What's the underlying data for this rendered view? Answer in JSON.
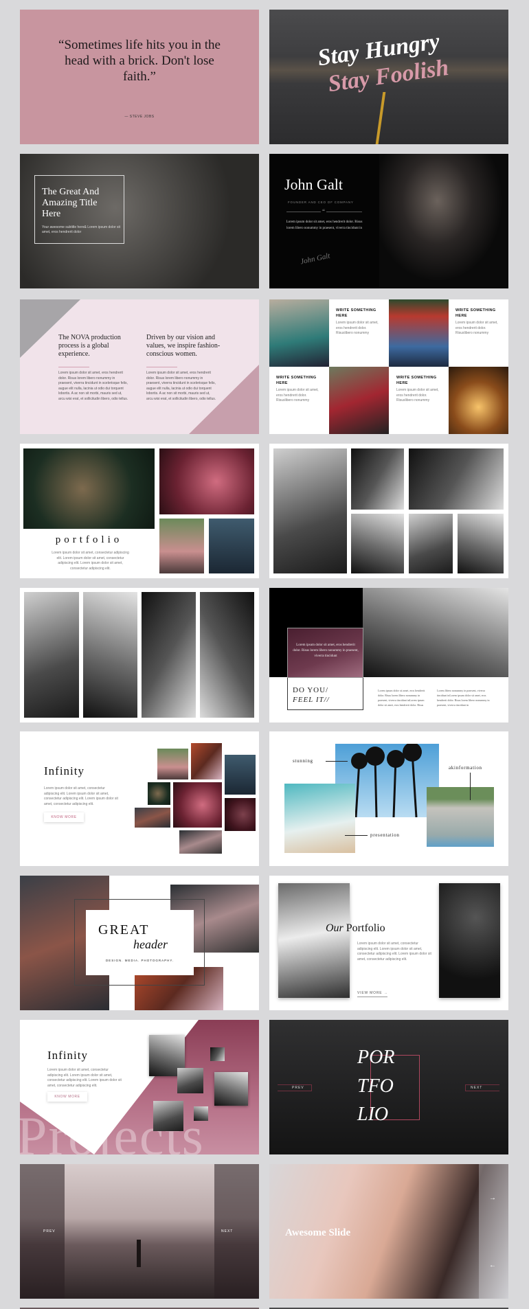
{
  "slides": {
    "quote": {
      "text": "“Sometimes life hits you in the head with a brick. Don't lose faith.”",
      "author": "— STEVE JOBS",
      "bg": "#c8959f"
    },
    "stay_hungry": {
      "line1": "Stay Hungry",
      "line2": "Stay Foolish",
      "accent": "#d79aa9"
    },
    "great_title": {
      "title": "The Great And Amazing Title Here",
      "subtitle": "Your awesome subtitle here& Lorem ipsum dolor sit amet, eros hendrerit dolor"
    },
    "john_galt": {
      "name": "John Galt",
      "role": "FOUNDER AND CEO OF COMPANY",
      "quote_mark": "“",
      "text": "Lorem ipsum dolor sit amet, eros hendrerit dolor. Risus lorem libero nonummy in praesent, viverra tincidunt in",
      "signature": "John Galt"
    },
    "nova": {
      "columns": [
        {
          "heading": "The NOVA production process is a global experience.",
          "text": "Lorem ipsum dolor sit amet, eros hendrerit dolor. Risus lorem libero nonummy in praesent, viverra tincidunt in scelerisque felis, augue elit nulla, lacinia ut odio dui torquent lobortis. A ac non sit morbi, mauris sed ut, arcu wisi erat, et sollicitudin libero, odio tellus."
        },
        {
          "heading": "Driven by our vision and values, we inspire fashion-conscious women.",
          "text": "Lorem ipsum dolor sit amet, eros hendrerit dolor. Risus lorem libero nonummy in praesent, viverra tincidunt in scelerisque felis, augue elit nulla, lacinia ut odio dui torquent lobortis. A ac non sit morbi, mauris sed ut, arcu wisi erat, et sollicitudin libero, odio tellus."
        }
      ]
    },
    "write_something": {
      "cards": [
        {
          "heading": "WRITE SOMETHING HERE",
          "text": "Lorem ipsum dolor sit amet, eros hendrerit dolor. Risuslibero nonummy"
        },
        {
          "heading": "WRITE SOMETHING HERE",
          "text": "Lorem ipsum dolor sit amet, eros hendrerit dolor. Risuslibero nonummy"
        },
        {
          "heading": "WRITE SOMETHING HERE",
          "text": "Lorem ipsum dolor sit amet, eros hendrerit dolor. Risuslibero nonummy"
        },
        {
          "heading": "WRITE SOMETHING HERE",
          "text": "Lorem ipsum dolor sit amet, eros hendrerit dolor. Risuslibero nonummy"
        }
      ]
    },
    "portfolio": {
      "title": "portfolio",
      "text": "Lorem ipsum dolor sit amet, consectetur adipiscing elit. Lorem ipsum dolor sit amet, consectetur adipiscing elit. Lorem ipsum dolor sit amet, consectetur adipiscing elit."
    },
    "do_you_feel": {
      "box_text": "Lorem ipsum dolor sit amet, eros hendrerit dolor. Risus lorem libero nonummy in praesent, viverra tincidunt",
      "title1": "DO YOU/",
      "title2": "FEEL IT//",
      "col1": "Lorem ipsum dolor sit amet, eros hendrerit dolor. Risus lorem libero nonummy in praesent, viverra tincidunt inLorem ipsum dolor sit amet, eros hendrerit dolor. Risus",
      "col2": "Lorem libero nonummy in praesent, viverra tincidunt inLorem ipsum dolor sit amet, eros hendrerit dolor. Risus lorem libero nonummy in praesent, viverra tincidunt in",
      "accent": "#6e3a4e"
    },
    "infinity_collage": {
      "title": "Infinity",
      "text": "Lorem ipsum dolor sit amet, consectetur adipiscing elit. Lorem ipsum dolor sit amet, consectetur adipiscing elit. Lorem ipsum dolor sit amet, consectetur adipiscing elit.",
      "button": "KNOW MORE",
      "accent": "#c0607e"
    },
    "labels": {
      "stunning": "stunning",
      "akinformation": "akinformation",
      "presentation": "presentation"
    },
    "great_header": {
      "line1": "GREAT",
      "line2": "header",
      "tagline": "DESIGN.  MEDIA.  PHOTOGRAPHY."
    },
    "our_portfolio": {
      "title_italic": "Our",
      "title": "Portfolio",
      "text": "Lorem ipsum dolor sit amet, consectetur adipiscing elit. Lorem ipsum dolor sit amet, consectetur adipiscing elit. Lorem ipsum dolor sit amet, consectetur adipiscing elit.",
      "button": "VIEW MORE",
      "arrow": "→"
    },
    "infinity_projects": {
      "title": "Infinity",
      "text": "Lorem ipsum dolor sit amet, consectetur adipiscing elit. Lorem ipsum dolor sit amet, consectetur adipiscing elit. Lorem ipsum dolor sit amet, consectetur adipiscing elit.",
      "button": "KNOW MORE",
      "watermark": "Projects",
      "accent": "#b56f86"
    },
    "portfolio_dark": {
      "line1": "POR",
      "line2": "TFO",
      "line3": "LIO",
      "prev": "PREV",
      "next": "NEXT",
      "accent": "#b0485f"
    },
    "prev_next": {
      "prev": "PREV",
      "next": "NEXT"
    },
    "awesome": {
      "title": "Awesome Slide",
      "arrow_right": "→",
      "arrow_left": "←"
    }
  }
}
